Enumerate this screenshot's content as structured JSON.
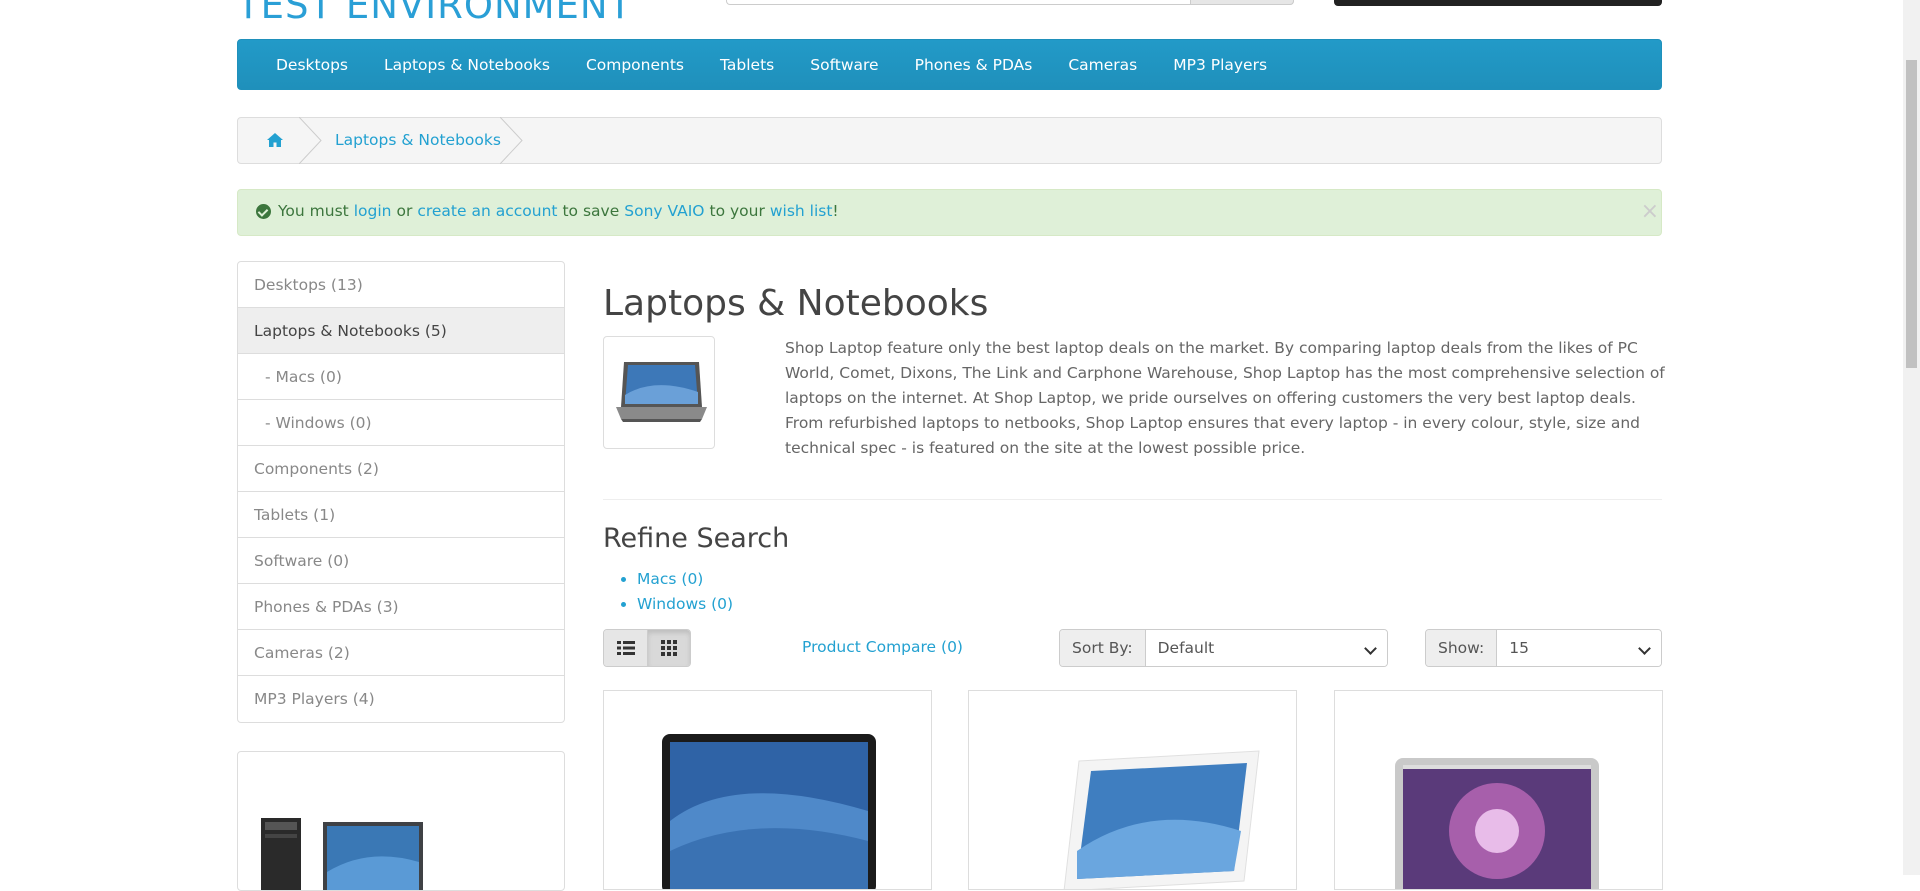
{
  "header": {
    "logo_text": "TEST ENVIRONMENT"
  },
  "nav": {
    "items": [
      "Desktops",
      "Laptops & Notebooks",
      "Components",
      "Tablets",
      "Software",
      "Phones & PDAs",
      "Cameras",
      "MP3 Players"
    ]
  },
  "breadcrumb": {
    "home_icon": "home-icon",
    "current": "Laptops & Notebooks"
  },
  "alert": {
    "prefix": "You must",
    "login": "login",
    "or": "or",
    "create_account": "create an account",
    "to_save": "to save",
    "product": "Sony VAIO",
    "to_your": "to your",
    "wish_list": "wish list",
    "suffix": "!",
    "close": "×"
  },
  "sidebar": {
    "items": [
      {
        "label": "Desktops (13)"
      },
      {
        "label": "Laptops & Notebooks (5)"
      },
      {
        "label": "- Macs (0)"
      },
      {
        "label": "- Windows (0)"
      },
      {
        "label": "Components (2)"
      },
      {
        "label": "Tablets (1)"
      },
      {
        "label": "Software (0)"
      },
      {
        "label": "Phones & PDAs (3)"
      },
      {
        "label": "Cameras (2)"
      },
      {
        "label": "MP3 Players (4)"
      }
    ]
  },
  "category": {
    "title": "Laptops & Notebooks",
    "description": "Shop Laptop feature only the best laptop deals on the market. By comparing laptop deals from the likes of PC World, Comet, Dixons, The Link and Carphone Warehouse, Shop Laptop has the most comprehensive selection of laptops on the internet. At Shop Laptop, we pride ourselves on offering customers the very best laptop deals. From refurbished laptops to netbooks, Shop Laptop ensures that every laptop - in every colour, style, size and technical spec - is featured on the site at the lowest possible price."
  },
  "refine": {
    "title": "Refine Search",
    "items": [
      "Macs (0)",
      "Windows (0)"
    ]
  },
  "toolbar": {
    "list_icon": "list-view-icon",
    "grid_icon": "grid-view-icon",
    "compare": "Product Compare (0)",
    "sort_label": "Sort By:",
    "sort_value": "Default",
    "show_label": "Show:",
    "show_value": "15"
  },
  "colors": {
    "accent": "#229ac8",
    "alert_bg": "#dff0d8",
    "link": "#23a1d1"
  }
}
